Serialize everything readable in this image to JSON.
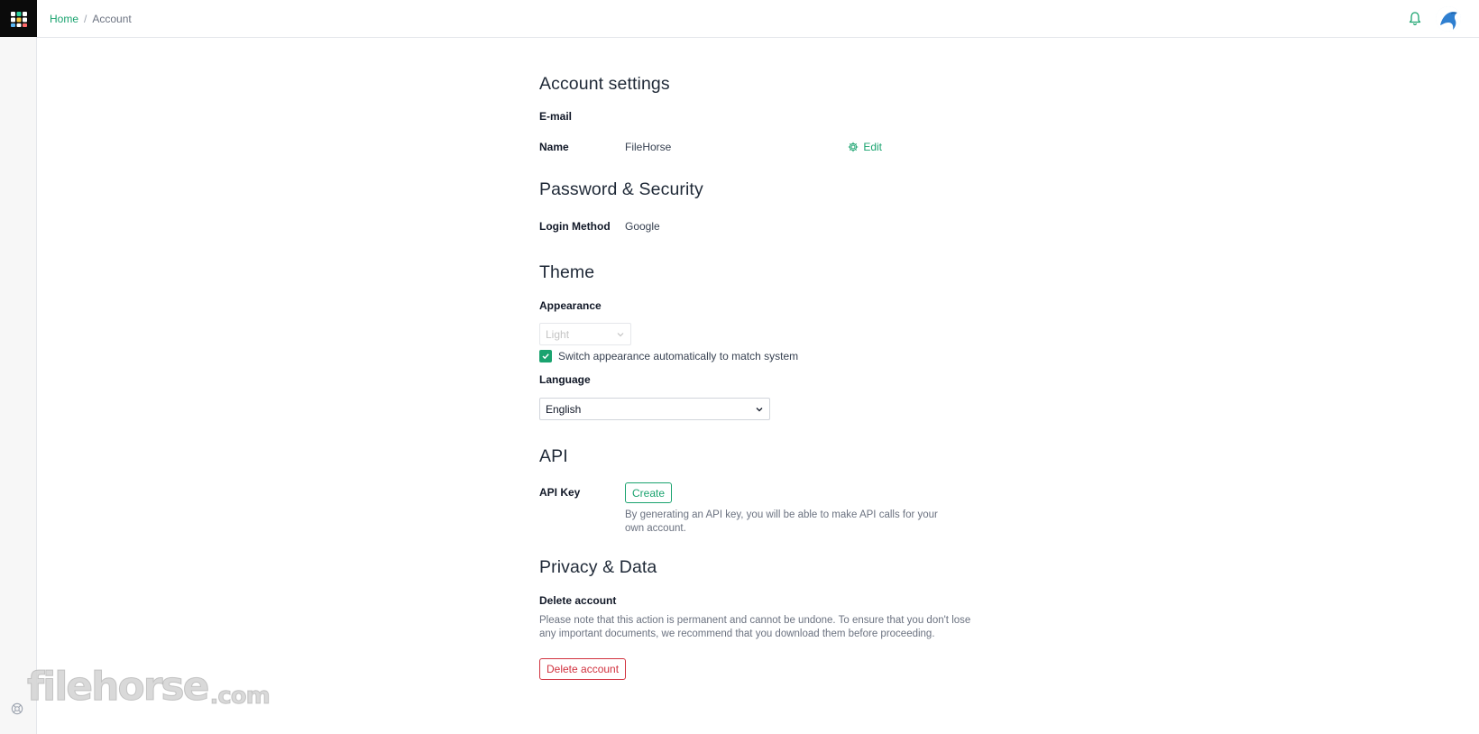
{
  "breadcrumb": {
    "home": "Home",
    "separator": "/",
    "current": "Account"
  },
  "header": {
    "notification_icon": "bell-icon",
    "avatar_icon": "user-avatar"
  },
  "account_settings": {
    "title": "Account settings",
    "email_label": "E-mail",
    "name_label": "Name",
    "name_value": "FileHorse",
    "edit_label": "Edit"
  },
  "password_security": {
    "title": "Password & Security",
    "login_method_label": "Login Method",
    "login_method_value": "Google"
  },
  "theme": {
    "title": "Theme",
    "appearance_label": "Appearance",
    "appearance_value": "Light",
    "auto_switch_label": "Switch appearance automatically to match system",
    "auto_switch_checked": true,
    "language_label": "Language",
    "language_value": "English"
  },
  "api": {
    "title": "API",
    "api_key_label": "API Key",
    "create_label": "Create",
    "help_text": "By generating an API key, you will be able to make API calls for your own account."
  },
  "privacy": {
    "title": "Privacy & Data",
    "delete_label": "Delete account",
    "delete_help": "Please note that this action is permanent and cannot be undone. To ensure that you don't lose any important documents, we recommend that you download them before proceeding.",
    "delete_button": "Delete account"
  },
  "watermark": {
    "main": "filehorse",
    "suffix": ".com"
  },
  "colors": {
    "accent": "#1aa36f",
    "danger": "#d1323f",
    "logo_bg": "#0b0b0b"
  }
}
